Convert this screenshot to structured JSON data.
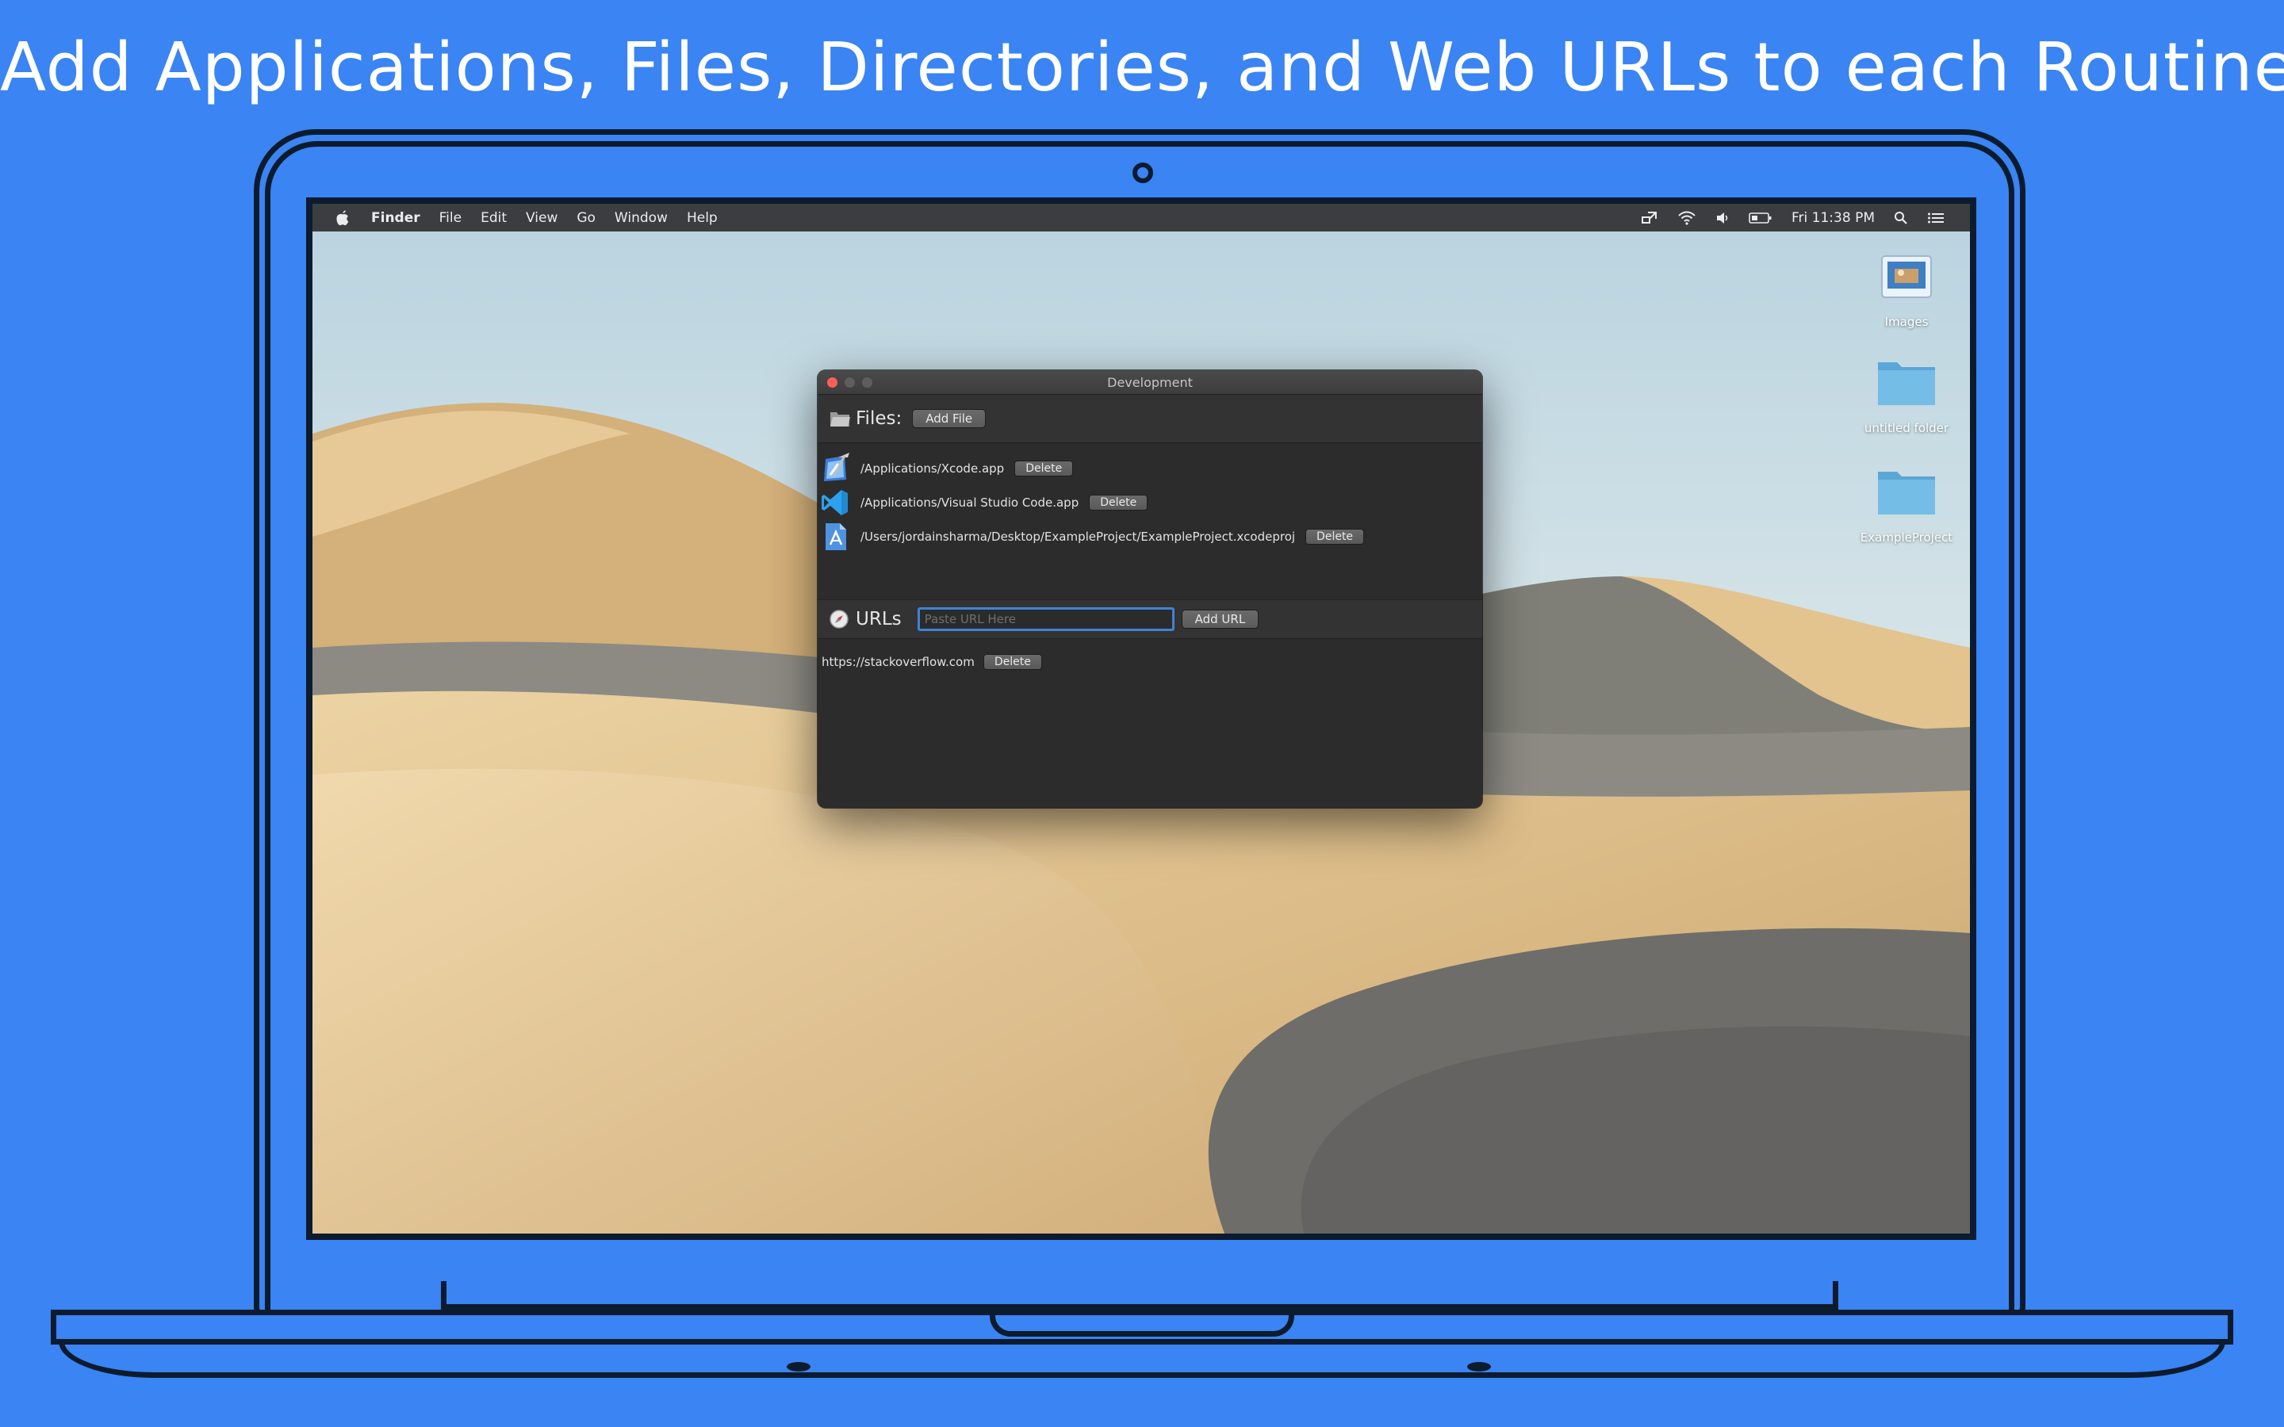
{
  "headline": "Add Applications, Files, Directories, and Web URLs to each Routine",
  "menubar": {
    "app": "Finder",
    "items": [
      "File",
      "Edit",
      "View",
      "Go",
      "Window",
      "Help"
    ],
    "clock": "Fri 11:38 PM"
  },
  "desktop": {
    "icons": [
      {
        "label": "Images",
        "icon": "image-folder-icon"
      },
      {
        "label": "untitled folder",
        "icon": "folder-icon"
      },
      {
        "label": "ExampleProject",
        "icon": "folder-icon"
      }
    ]
  },
  "window": {
    "title": "Development",
    "files": {
      "label": "Files:",
      "add_label": "Add File",
      "items": [
        {
          "path": "/Applications/Xcode.app",
          "icon": "xcode-icon"
        },
        {
          "path": "/Applications/Visual Studio Code.app",
          "icon": "vscode-icon"
        },
        {
          "path": "/Users/jordainsharma/Desktop/ExampleProject/ExampleProject.xcodeproj",
          "icon": "xcodeproj-file-icon"
        }
      ],
      "delete_label": "Delete"
    },
    "urls": {
      "label": "URLs",
      "placeholder": "Paste URL Here",
      "add_label": "Add URL",
      "items": [
        {
          "url": "https://stackoverflow.com"
        }
      ],
      "delete_label": "Delete"
    }
  }
}
